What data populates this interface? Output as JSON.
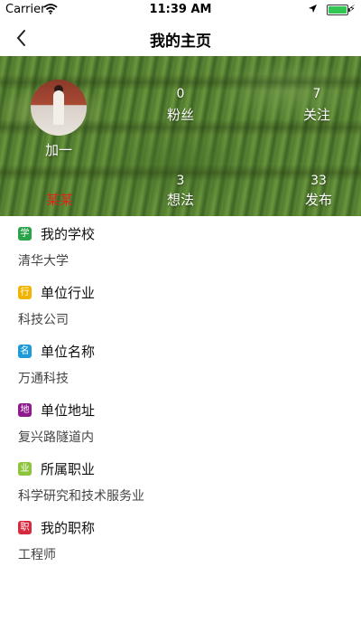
{
  "status_bar": {
    "carrier": "Carrier",
    "time": "11:39 AM"
  },
  "nav": {
    "title": "我的主页"
  },
  "profile": {
    "name": "加一",
    "red_label": "某某",
    "stats": [
      {
        "value": "0",
        "label": "粉丝"
      },
      {
        "value": "7",
        "label": "关注"
      },
      {
        "value": "3",
        "label": "想法"
      },
      {
        "value": "33",
        "label": "发布"
      }
    ]
  },
  "info": [
    {
      "badge": "学",
      "badge_color": "#2aa44a",
      "label": "我的学校",
      "value": "清华大学"
    },
    {
      "badge": "行",
      "badge_color": "#f0b400",
      "label": "单位行业",
      "value": "科技公司"
    },
    {
      "badge": "名",
      "badge_color": "#1d9bd9",
      "label": "单位名称",
      "value": "万通科技"
    },
    {
      "badge": "地",
      "badge_color": "#8e1a8e",
      "label": "单位地址",
      "value": "复兴路隧道内"
    },
    {
      "badge": "业",
      "badge_color": "#8cc43c",
      "label": "所属职业",
      "value": "科学研究和技术服务业"
    },
    {
      "badge": "职",
      "badge_color": "#d8283c",
      "label": "我的职称",
      "value": "工程师"
    }
  ]
}
